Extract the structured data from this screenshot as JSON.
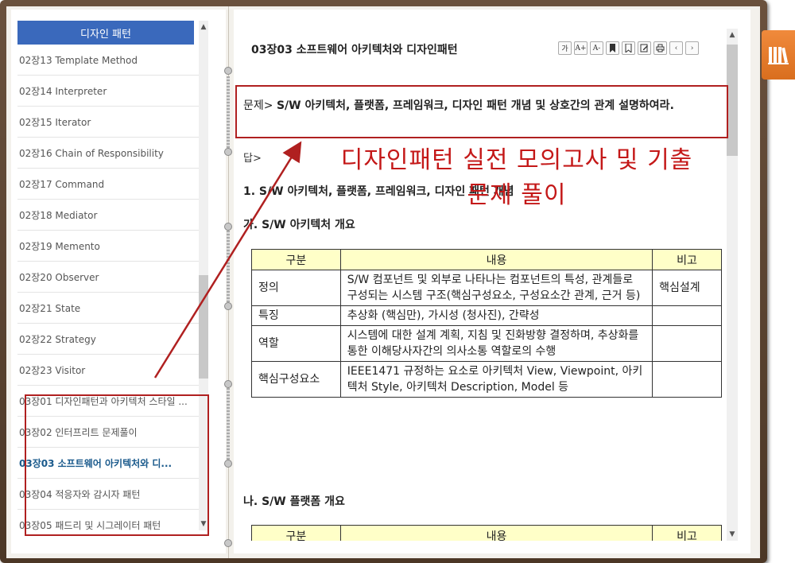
{
  "toc": {
    "header": "디자인 패턴",
    "items": [
      {
        "label": "02장13 Template Method",
        "active": false
      },
      {
        "label": "02장14 Interpreter",
        "active": false
      },
      {
        "label": "02장15 Iterator",
        "active": false
      },
      {
        "label": "02장16 Chain of Responsibility",
        "active": false
      },
      {
        "label": "02장17 Command",
        "active": false
      },
      {
        "label": "02장18 Mediator",
        "active": false
      },
      {
        "label": "02장19 Memento",
        "active": false
      },
      {
        "label": "02장20 Observer",
        "active": false
      },
      {
        "label": "02장21 State",
        "active": false
      },
      {
        "label": "02장22 Strategy",
        "active": false
      },
      {
        "label": "02장23 Visitor",
        "active": false
      },
      {
        "label": "03장01 디자인패턴과 아키텍처 스타일 ...",
        "active": false
      },
      {
        "label": "03장02 인터프리트 문제풀이",
        "active": false
      },
      {
        "label": "03장03 소프트웨어 아키텍처와 디...",
        "active": true
      },
      {
        "label": "03장04 적응자와 감시자 패턴",
        "active": false
      },
      {
        "label": "03장05 패드리 및 시그레이터 패턴",
        "active": false
      }
    ]
  },
  "doc": {
    "title": "03장03 소프트웨어 아키텍처와 디자인패턴",
    "toolbar": [
      "가",
      "A+",
      "A-",
      "bookmark-icon",
      "bookmark-list-icon",
      "edit-icon",
      "print-icon",
      "prev-icon",
      "next-icon"
    ],
    "question_prefix": "문제> ",
    "question_text": "S/W 아키텍처, 플랫폼, 프레임워크, 디자인 패턴 개념 및 상호간의 관계 설명하여라.",
    "answer_label": "답>",
    "section1": "1. S/W 아키텍처, 플랫폼, 프레임워크, 디자인 패턴 개념",
    "sub_a": "가. S/W 아키텍처 개요",
    "table1": {
      "headers": [
        "구분",
        "내용",
        "비고"
      ],
      "rows": [
        [
          "정의",
          "S/W 컴포넌트 및 외부로 나타나는 컴포넌트의 특성, 관계들로 구성되는 시스템 구조(핵심구성요소, 구성요소간 관계, 근거 등)",
          "핵심설계"
        ],
        [
          "특징",
          "추상화 (핵심만), 가시성 (청사진), 간략성",
          ""
        ],
        [
          "역할",
          "시스템에 대한 설계 계획, 지침 및 진화방향 결정하며, 추상화를 통한 이해당사자간의 의사소통 역할로의 수행",
          ""
        ],
        [
          "핵심구성요소",
          "IEEE1471 규정하는 요소로 아키텍처 View, Viewpoint, 아키텍처 Style, 아키텍처 Description, Model 등",
          ""
        ]
      ]
    },
    "sub_b": "나. S/W 플랫폼 개요",
    "table2": {
      "headers": [
        "구분",
        "내용",
        "비고"
      ]
    }
  },
  "annotation": "디자인패턴 실전 모의고사 및 기출문제 풀이",
  "colors": {
    "toc_header": "#3a69bc",
    "accent_red": "#b02020",
    "table_header": "#ffffc8",
    "shelf_tab": "#e57a2a"
  }
}
